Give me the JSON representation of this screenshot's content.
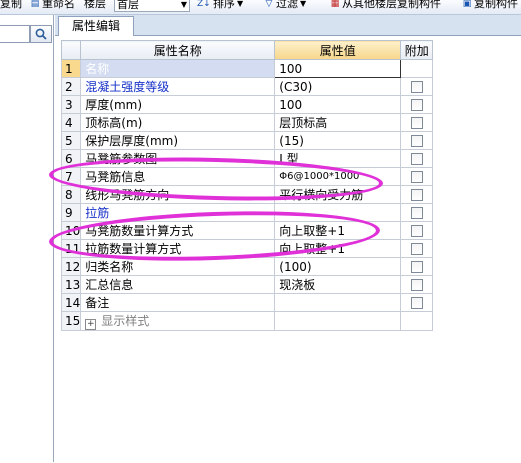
{
  "toolbar": {
    "copy_label": "复制",
    "rename_label": "重命名",
    "floor_label": "楼层",
    "floor_value": "首层",
    "sort_label": "排序",
    "filter_label": "过滤",
    "copy_from_floor_label": "从其他楼层复制构件",
    "copy_component_label": "复制构件"
  },
  "panel": {
    "tab_label": "属性编辑",
    "columns": [
      "属性名称",
      "属性值",
      "附加"
    ],
    "rows": [
      {
        "num": "1",
        "name": "名称",
        "value": "100",
        "checkbox": false
      },
      {
        "num": "2",
        "name": "混凝土强度等级",
        "value": "(C30)",
        "checkbox": true
      },
      {
        "num": "3",
        "name": "厚度(mm)",
        "value": "100",
        "checkbox": true
      },
      {
        "num": "4",
        "name": "顶标高(m)",
        "value": "层顶标高",
        "checkbox": true
      },
      {
        "num": "5",
        "name": "保护层厚度(mm)",
        "value": "(15)",
        "checkbox": true
      },
      {
        "num": "6",
        "name": "马凳筋参数图",
        "value": "I 型",
        "checkbox": true
      },
      {
        "num": "7",
        "name": "马凳筋信息",
        "value": "Φ6@1000*1000",
        "checkbox": true
      },
      {
        "num": "8",
        "name": "线形马凳筋方向",
        "value": "平行横向受力筋",
        "checkbox": true
      },
      {
        "num": "9",
        "name": "拉筋",
        "value": "",
        "checkbox": true
      },
      {
        "num": "10",
        "name": "马凳筋数量计算方式",
        "value": "向上取整+1",
        "checkbox": true
      },
      {
        "num": "11",
        "name": "拉筋数量计算方式",
        "value": "向上取整+1",
        "checkbox": true
      },
      {
        "num": "12",
        "name": "归类名称",
        "value": "(100)",
        "checkbox": true
      },
      {
        "num": "13",
        "name": "汇总信息",
        "value": "现浇板",
        "checkbox": true
      },
      {
        "num": "14",
        "name": "备注",
        "value": "",
        "checkbox": true
      },
      {
        "num": "15",
        "name": "显示样式",
        "value": "",
        "checkbox": false
      }
    ]
  },
  "colors": {
    "annotation": "#e030d8",
    "header_highlight": "#f7d68a",
    "blue_text": "#1530c8",
    "panel_bg": "#d7e2f0"
  }
}
